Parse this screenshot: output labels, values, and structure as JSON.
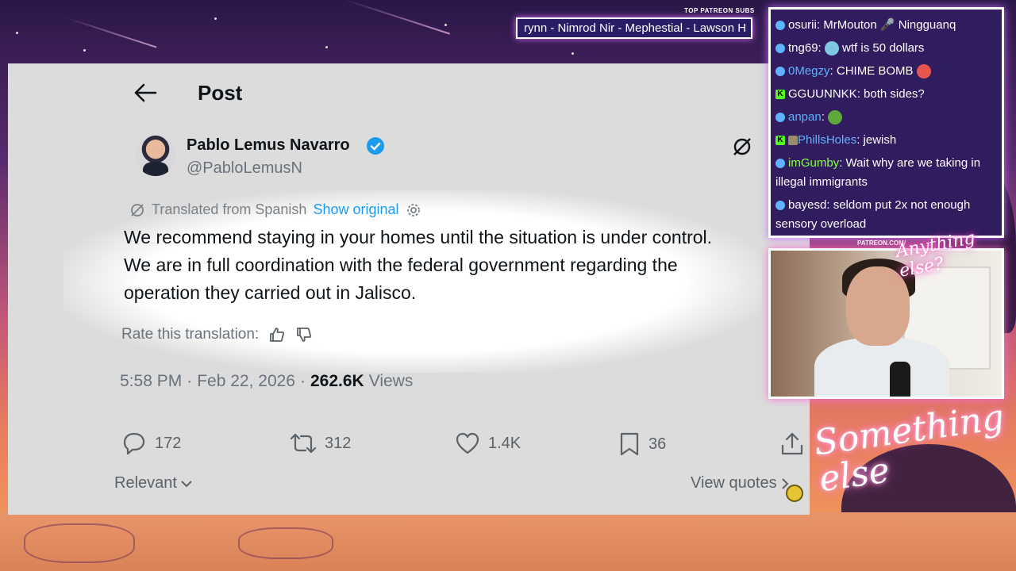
{
  "ticker": {
    "label": "TOP PATREON SUBS",
    "text": "rynn - Nimrod Nir - Mephestial - Lawson H"
  },
  "post": {
    "header_title": "Post",
    "author_name": "Pablo Lemus Navarro",
    "author_handle": "@PabloLemusN",
    "translated_label": "Translated from Spanish",
    "show_original": "Show original",
    "text": "We recommend staying in your homes until the situation is under control. We are in full coordination with the federal government regarding the operation they carried out in Jalisco.",
    "rate_label": "Rate this translation:",
    "time": "5:58 PM",
    "date": "Feb 22, 2026",
    "dot": "·",
    "views_count": "262.6K",
    "views_label": "Views",
    "replies": "172",
    "reposts": "312",
    "likes": "1.4K",
    "bookmarks": "36",
    "sort_label": "Relevant",
    "view_quotes": "View quotes"
  },
  "chat": {
    "messages": [
      {
        "user": "osurii",
        "sep": ":",
        "text": " MrMouton 🎤 Ningguanq"
      },
      {
        "user": "tng69",
        "sep": ":",
        "text": " wtf is 50 dollars"
      },
      {
        "user": "0Megzy",
        "sep": ":",
        "text": " CHIME BOMB"
      },
      {
        "user": "GGUUNNKK",
        "sep": ":",
        "text": " both sides?"
      },
      {
        "user": "anpan",
        "sep": ":",
        "text": ""
      },
      {
        "user": "PhillsHoles",
        "sep": ":",
        "text": " jewish"
      },
      {
        "user": "imGumby",
        "sep": ":",
        "text": " Wait why are we taking in illegal immigrants"
      },
      {
        "user": "bayesd",
        "sep": ":",
        "text": " seldom put 2x not enough sensory overload"
      }
    ]
  },
  "overlay": {
    "patreon_tag": "PATREON.COM/",
    "neon_small": "Anything else?",
    "neon_big": "Something else"
  },
  "colors": {
    "link": "#1d9bf0",
    "verified": "#1d9bf0",
    "chat_bg": "#301c5e"
  }
}
